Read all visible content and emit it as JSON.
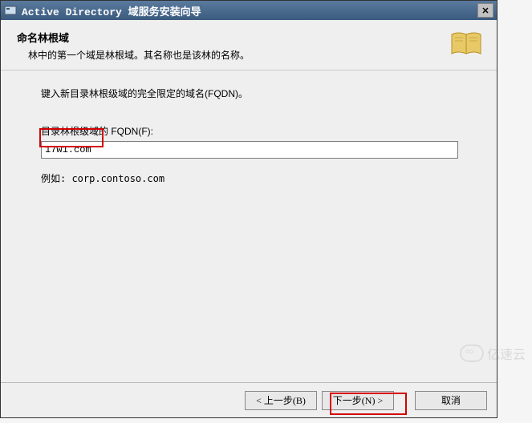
{
  "titlebar": {
    "title_en": "Active Directory ",
    "title_cn": "域服务安装向导"
  },
  "header": {
    "title": "命名林根域",
    "subtitle": "林中的第一个域是林根域。其名称也是该林的名称。"
  },
  "content": {
    "instruction": "键入新目录林根级域的完全限定的域名(FQDN)。",
    "field_label": "目录林根级域的 FQDN(F):",
    "fqdn_value": "17w1.com",
    "example": "例如: corp.contoso.com"
  },
  "buttons": {
    "back": "< 上一步(B)",
    "next": "下一步(N) >",
    "cancel": "取消"
  },
  "watermark": "亿速云"
}
